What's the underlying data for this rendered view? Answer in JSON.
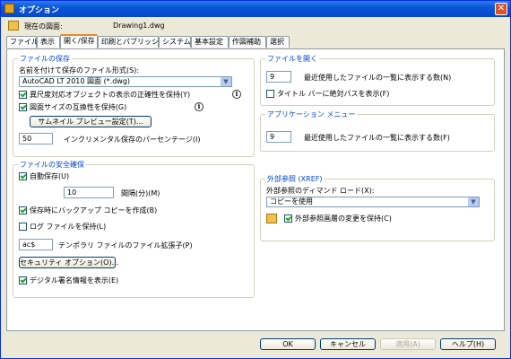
{
  "window": {
    "title": "オプション",
    "close": "✕"
  },
  "current_drawing": {
    "label": "現在の図面:",
    "value": "Drawing1.dwg"
  },
  "tabs": [
    {
      "label": "ファイル"
    },
    {
      "label": "表示"
    },
    {
      "label": "開く/保存"
    },
    {
      "label": "印刷とパブリッシュ"
    },
    {
      "label": "システム"
    },
    {
      "label": "基本設定"
    },
    {
      "label": "作図補助"
    },
    {
      "label": "選択"
    }
  ],
  "file_save": {
    "title": "ファイルの保存",
    "format_label": "名前を付けて保存のファイル形式(S):",
    "format_value": "AutoCAD LT 2010 図面 (*.dwg)",
    "maintain_visual": "異尺度対応オブジェクトの表示の正確性を保持(Y)",
    "maintain_size": "図面サイズの互換性を保持(G)",
    "thumbnail_button": "サムネイル プレビュー設定(T)...",
    "incremental_value": "50",
    "incremental_label": "インクリメンタル保存のパーセンテージ(I)"
  },
  "file_safety": {
    "title": "ファイルの安全確保",
    "autosave_label": "自動保存(U)",
    "interval_value": "10",
    "interval_label": "間隔(分)(M)",
    "backup_label": "保存時にバックアップ コピーを作成(B)",
    "log_label": "ログ ファイルを保持(L)",
    "temp_ext_value": "ac$",
    "temp_ext_label": "テンポラリ ファイルのファイル拡張子(P)",
    "security_button": "セキュリティ オプション(O)...",
    "digital_sig_label": "デジタル署名情報を表示(E)"
  },
  "file_open": {
    "title": "ファイルを開く",
    "recent_value": "9",
    "recent_label": "最近使用したファイルの一覧に表示する数(N)",
    "fullpath_label": "タイトル バーに絶対パスを表示(F)"
  },
  "app_menu": {
    "title": "アプリケーション メニュー",
    "recent_value": "9",
    "recent_label": "最近使用したファイルの一覧に表示する数(F)"
  },
  "xref": {
    "title": "外部参照 (XREF)",
    "demand_label": "外部参照のディマンド ロード(X):",
    "demand_value": "コピーを使用",
    "retain_label": "外部参照画層の変更を保持(C)"
  },
  "buttons": {
    "ok": "OK",
    "cancel": "キャンセル",
    "apply": "適用(A)",
    "help": "ヘルプ(H)"
  },
  "info_glyph": "i",
  "dropdown_glyph": "▼"
}
